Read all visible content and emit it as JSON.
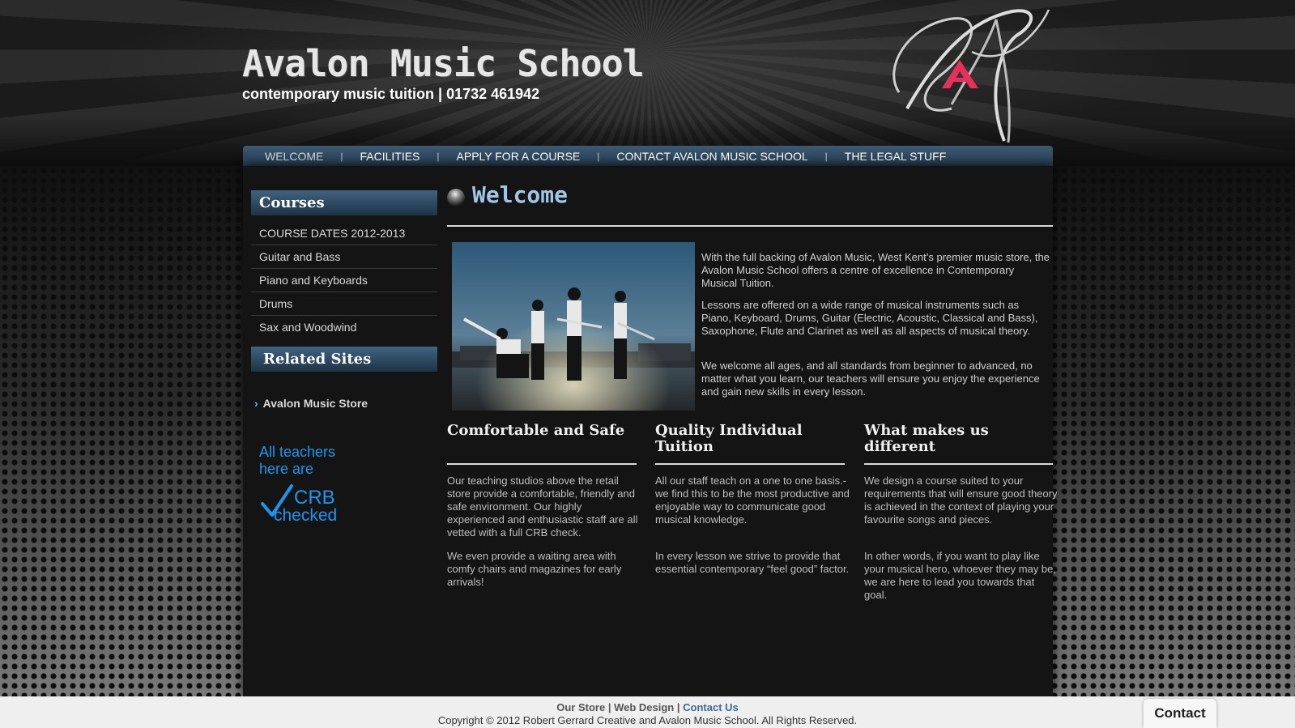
{
  "header": {
    "title": "Avalon Music School",
    "tagline": "contemporary music tuition | 01732 461942"
  },
  "nav": {
    "items": [
      "WELCOME",
      "FACILITIES",
      "APPLY FOR A COURSE",
      "CONTACT AVALON MUSIC SCHOOL",
      "THE LEGAL STUFF"
    ],
    "separator": "|",
    "active_index": 0
  },
  "sidebar": {
    "courses_heading": "Courses",
    "courses": [
      "COURSE DATES 2012-2013",
      "Guitar and Bass",
      "Piano and Keyboards",
      "Drums",
      "Sax and Woodwind"
    ],
    "related_heading": "Related Sites",
    "related_link": "Avalon Music Store",
    "crb_badge": [
      "All teachers",
      "here are",
      "CRB",
      "checked"
    ]
  },
  "main": {
    "title": "Welcome",
    "intro": [
      "With the full backing of Avalon Music, West Kent’s premier music store, the Avalon Music School offers a centre of excellence in Contemporary Musical Tuition.",
      "Lessons are offered on a wide range of musical instruments such as Piano, Keyboard, Drums, Guitar (Electric, Acoustic, Classical and Bass), Saxophone, Flute and Clarinet as well as all aspects of musical theory.",
      "We welcome all ages, and all standards from beginner to advanced, no matter what you learn, our teachers will ensure you enjoy the experience and gain new skills in every lesson."
    ],
    "columns": [
      {
        "heading": "Comfortable and Safe",
        "paragraphs": [
          "Our teaching studios above the retail store provide a comfortable, friendly and safe environment. Our highly experienced and enthusiastic staff are all vetted with a full CRB check.",
          "We even provide a waiting area with comfy chairs and magazines for early arrivals!"
        ]
      },
      {
        "heading": "Quality Individual Tuition",
        "paragraphs": [
          "All our staff teach on a one to one basis.- we find this to be the most productive and enjoyable way to communicate good musical knowledge.",
          "In every lesson we strive to provide that essential contemporary “feel good” factor."
        ]
      },
      {
        "heading": "What makes us different",
        "paragraphs": [
          "We design a course suited to your requirements that will ensure good theory is achieved in the context of playing your favourite songs and pieces.",
          "In other words, if you want to play like your musical hero, whoever they may be, we are here to lead you towards that goal."
        ]
      }
    ]
  },
  "footer": {
    "links": [
      "Our Store",
      "Web Design",
      "Contact Us"
    ],
    "separator": "|",
    "copyright": "Copyright © 2012 Robert Gerrard Creative and Avalon Music School. All Rights Reserved."
  },
  "contact_tab": "Contact",
  "colors": {
    "nav_bar": "#2f4b62",
    "heading_blue": "#9fc6e4",
    "crb_blue": "#1b97f0",
    "logo_pink": "#e8305a",
    "page_bg": "#141414"
  }
}
